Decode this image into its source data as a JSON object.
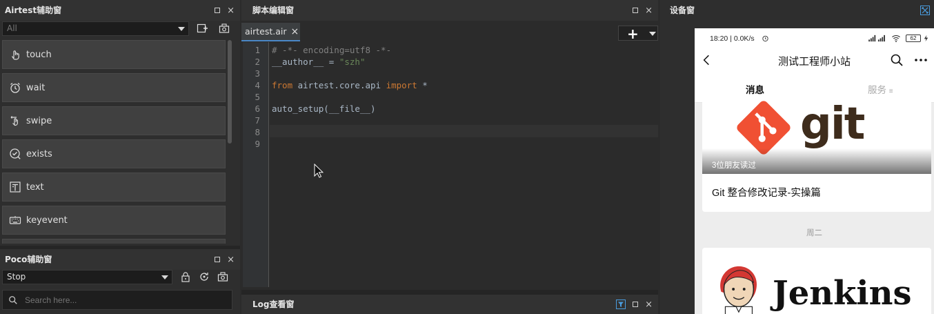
{
  "airtest_panel": {
    "title": "Airtest辅助窗",
    "filter": {
      "value": "All"
    },
    "api_items": [
      {
        "label": "touch",
        "icon": "touch-icon"
      },
      {
        "label": "wait",
        "icon": "alarm-clock-icon"
      },
      {
        "label": "swipe",
        "icon": "swipe-icon"
      },
      {
        "label": "exists",
        "icon": "check-circle-icon"
      },
      {
        "label": "text",
        "icon": "text-box-icon"
      },
      {
        "label": "keyevent",
        "icon": "keyboard-icon"
      }
    ]
  },
  "poco_panel": {
    "title": "Poco辅助窗",
    "mode": {
      "value": "Stop"
    },
    "search": {
      "placeholder": "Search here..."
    }
  },
  "editor_panel": {
    "title": "脚本编辑窗",
    "tab": {
      "label": "airtest.air",
      "close": "×"
    },
    "line_numbers": [
      "1",
      "2",
      "3",
      "4",
      "5",
      "6",
      "7",
      "8",
      "9"
    ],
    "code": {
      "line1": "# -*- encoding=utf8 -*-",
      "line2_name": "__author__",
      "line2_op": " = ",
      "line2_str": "\"szh\"",
      "line4_from": "from",
      "line4_module": " airtest.core.api ",
      "line4_import": "import",
      "line4_star": " *",
      "line6": "auto_setup(__file__)"
    }
  },
  "log_panel": {
    "title": "Log查看窗"
  },
  "device_panel": {
    "title": "设备窗",
    "phone": {
      "time": "18:20 | 0.0K/s",
      "battery": "62",
      "nav_title": "测试工程师小站",
      "tabs": [
        "消息",
        "服务"
      ],
      "article1": {
        "image_text": "git",
        "caption": "3位朋友读过",
        "title": "Git 整合修改记录-实操篇"
      },
      "date_separator": "周二",
      "article2": {
        "image_text": "Jenkins"
      }
    }
  },
  "colors": {
    "panel_bg": "#2e2e2e",
    "editor_bg": "#2b2b2b",
    "keyword": "#cc7832",
    "string": "#6a8759",
    "comment": "#808080",
    "git_orange": "#f05033",
    "jenkins_red": "#d33833"
  }
}
